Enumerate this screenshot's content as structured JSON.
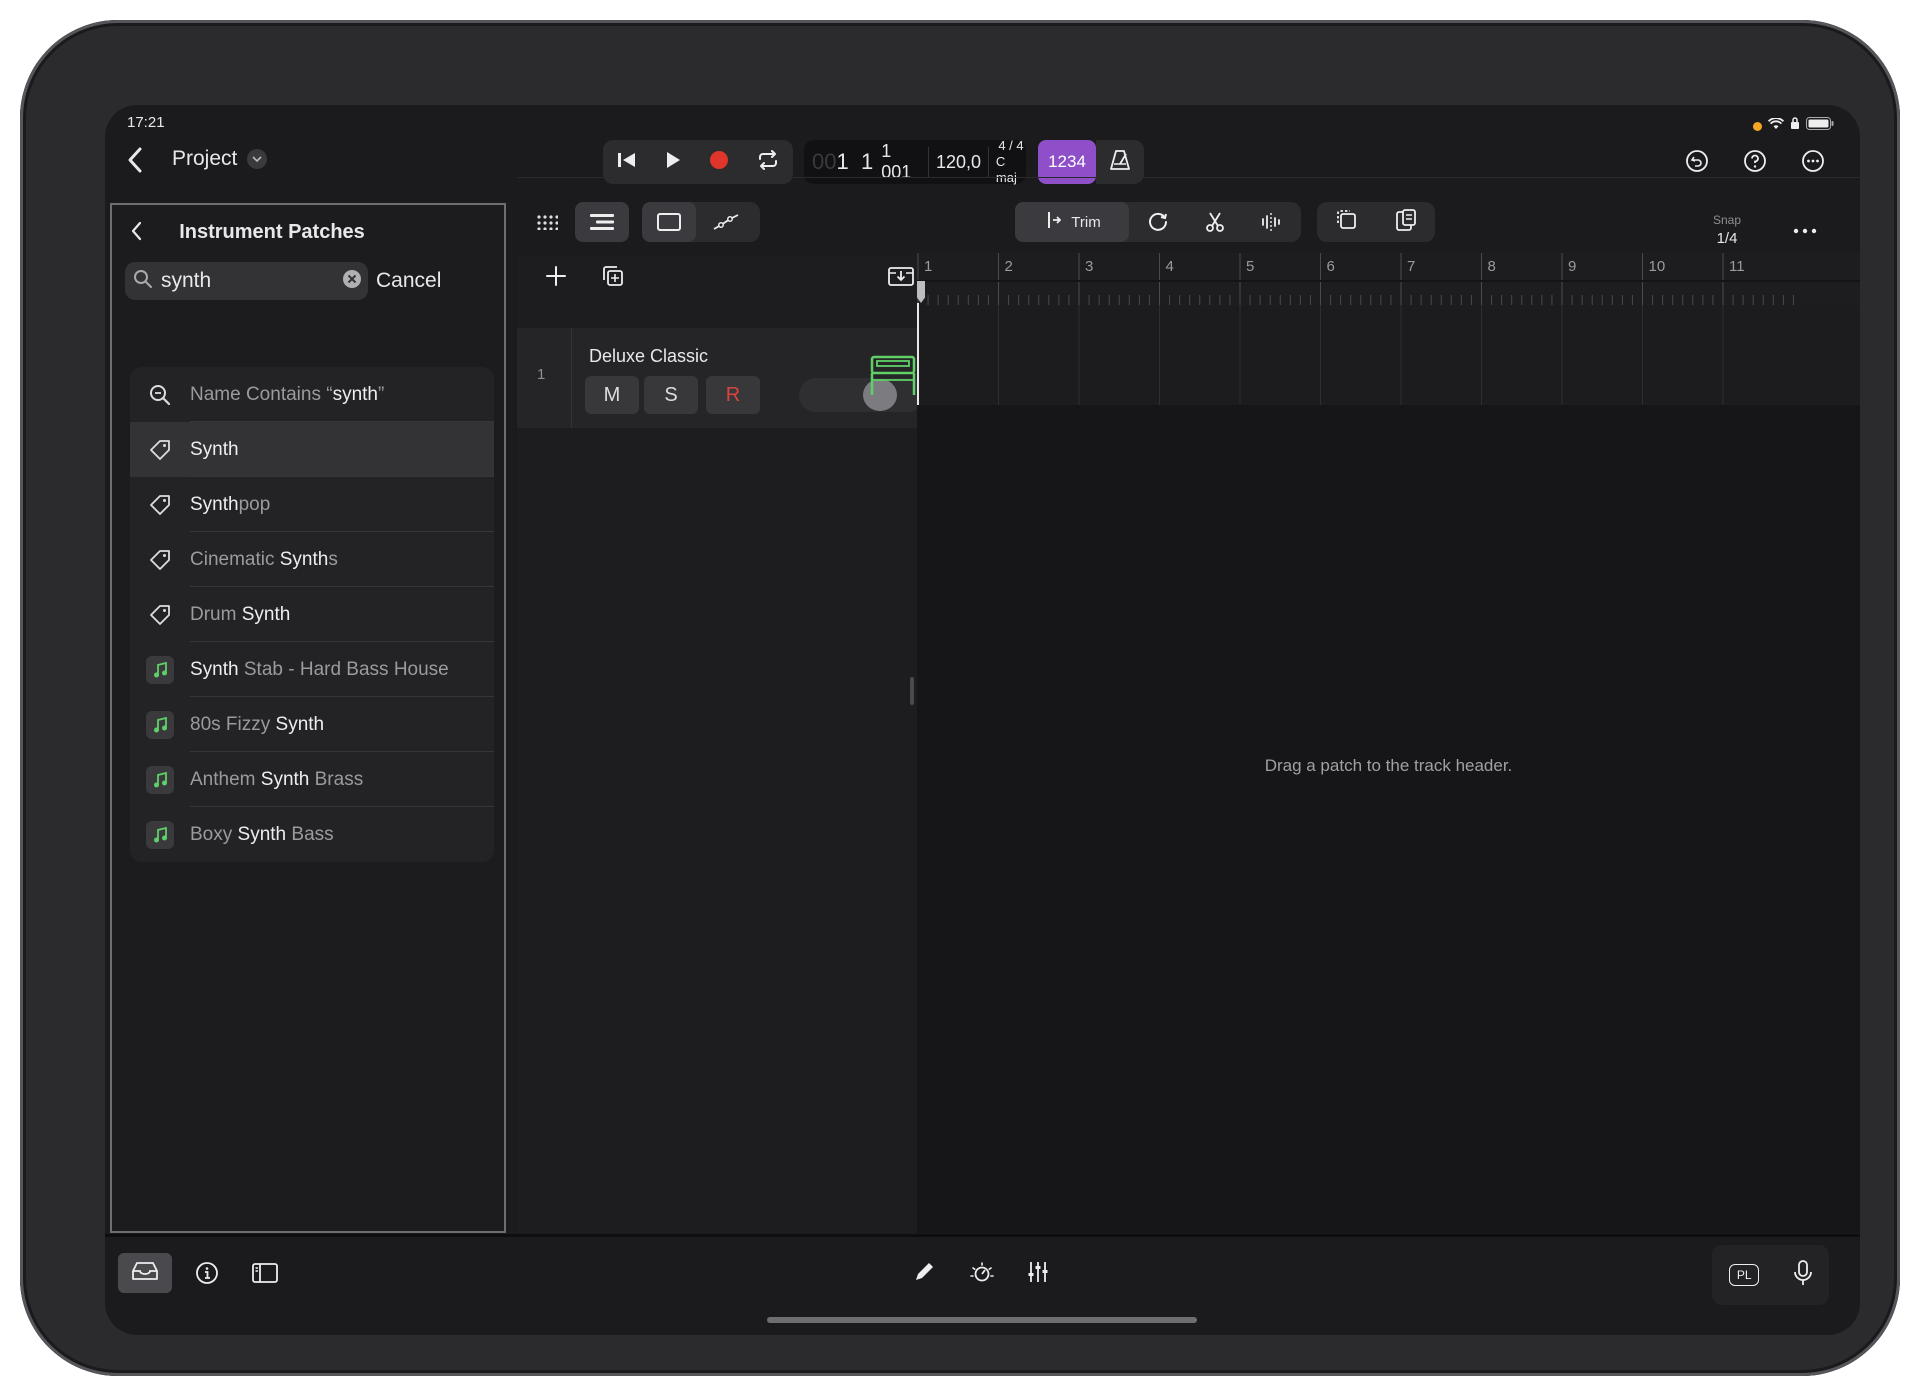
{
  "status_bar": {
    "time": "17:21"
  },
  "header": {
    "project_label": "Project",
    "position_faint": "00",
    "position_bars": "1  1",
    "position_ticks": "1 001",
    "tempo": "120,0",
    "time_signature": "4 / 4",
    "key": "C maj",
    "count_in_label": "1234"
  },
  "left_panel": {
    "title": "Instrument Patches",
    "search": {
      "value": "synth",
      "cancel_label": "Cancel"
    },
    "results": [
      {
        "type": "search",
        "icon": "magnifier-icon",
        "prefix": "Name Contains “",
        "match": "synth",
        "suffix": "”"
      },
      {
        "type": "tag",
        "icon": "tag-icon",
        "prefix": "",
        "match": "Synth",
        "suffix": "",
        "selected": true
      },
      {
        "type": "tag",
        "icon": "tag-icon",
        "prefix": "",
        "match": "Synth",
        "suffix": "pop"
      },
      {
        "type": "tag",
        "icon": "tag-icon",
        "prefix": "Cinematic ",
        "match": "Synth",
        "suffix": "s"
      },
      {
        "type": "tag",
        "icon": "tag-icon",
        "prefix": "Drum ",
        "match": "Synth",
        "suffix": ""
      },
      {
        "type": "patch",
        "icon": "music-note-icon",
        "prefix": "",
        "match": "Synth",
        "suffix": " Stab - Hard Bass House"
      },
      {
        "type": "patch",
        "icon": "music-note-icon",
        "prefix": "80s Fizzy ",
        "match": "Synth",
        "suffix": ""
      },
      {
        "type": "patch",
        "icon": "music-note-icon",
        "prefix": "Anthem ",
        "match": "Synth",
        "suffix": " Brass"
      },
      {
        "type": "patch",
        "icon": "music-note-icon",
        "prefix": "Boxy ",
        "match": "Synth",
        "suffix": " Bass"
      }
    ]
  },
  "tracks_toolbar": {
    "trim_label": "Trim",
    "snap_label": "Snap",
    "snap_value": "1/4"
  },
  "track": {
    "number": "1",
    "name": "Deluxe Classic",
    "mute_label": "M",
    "solo_label": "S",
    "record_label": "R"
  },
  "ruler": {
    "bars": [
      "1",
      "2",
      "3",
      "4",
      "5",
      "6",
      "7",
      "8",
      "9",
      "10",
      "11"
    ]
  },
  "empty_hint": "Drag a patch to the track header.",
  "bottom_bar": {
    "pl_label": "PL"
  },
  "colors": {
    "accent_purple": "#8e4fc8",
    "record_red": "#e0352b",
    "instrument_green": "#5fd068",
    "muted_r": "#d9453d"
  }
}
